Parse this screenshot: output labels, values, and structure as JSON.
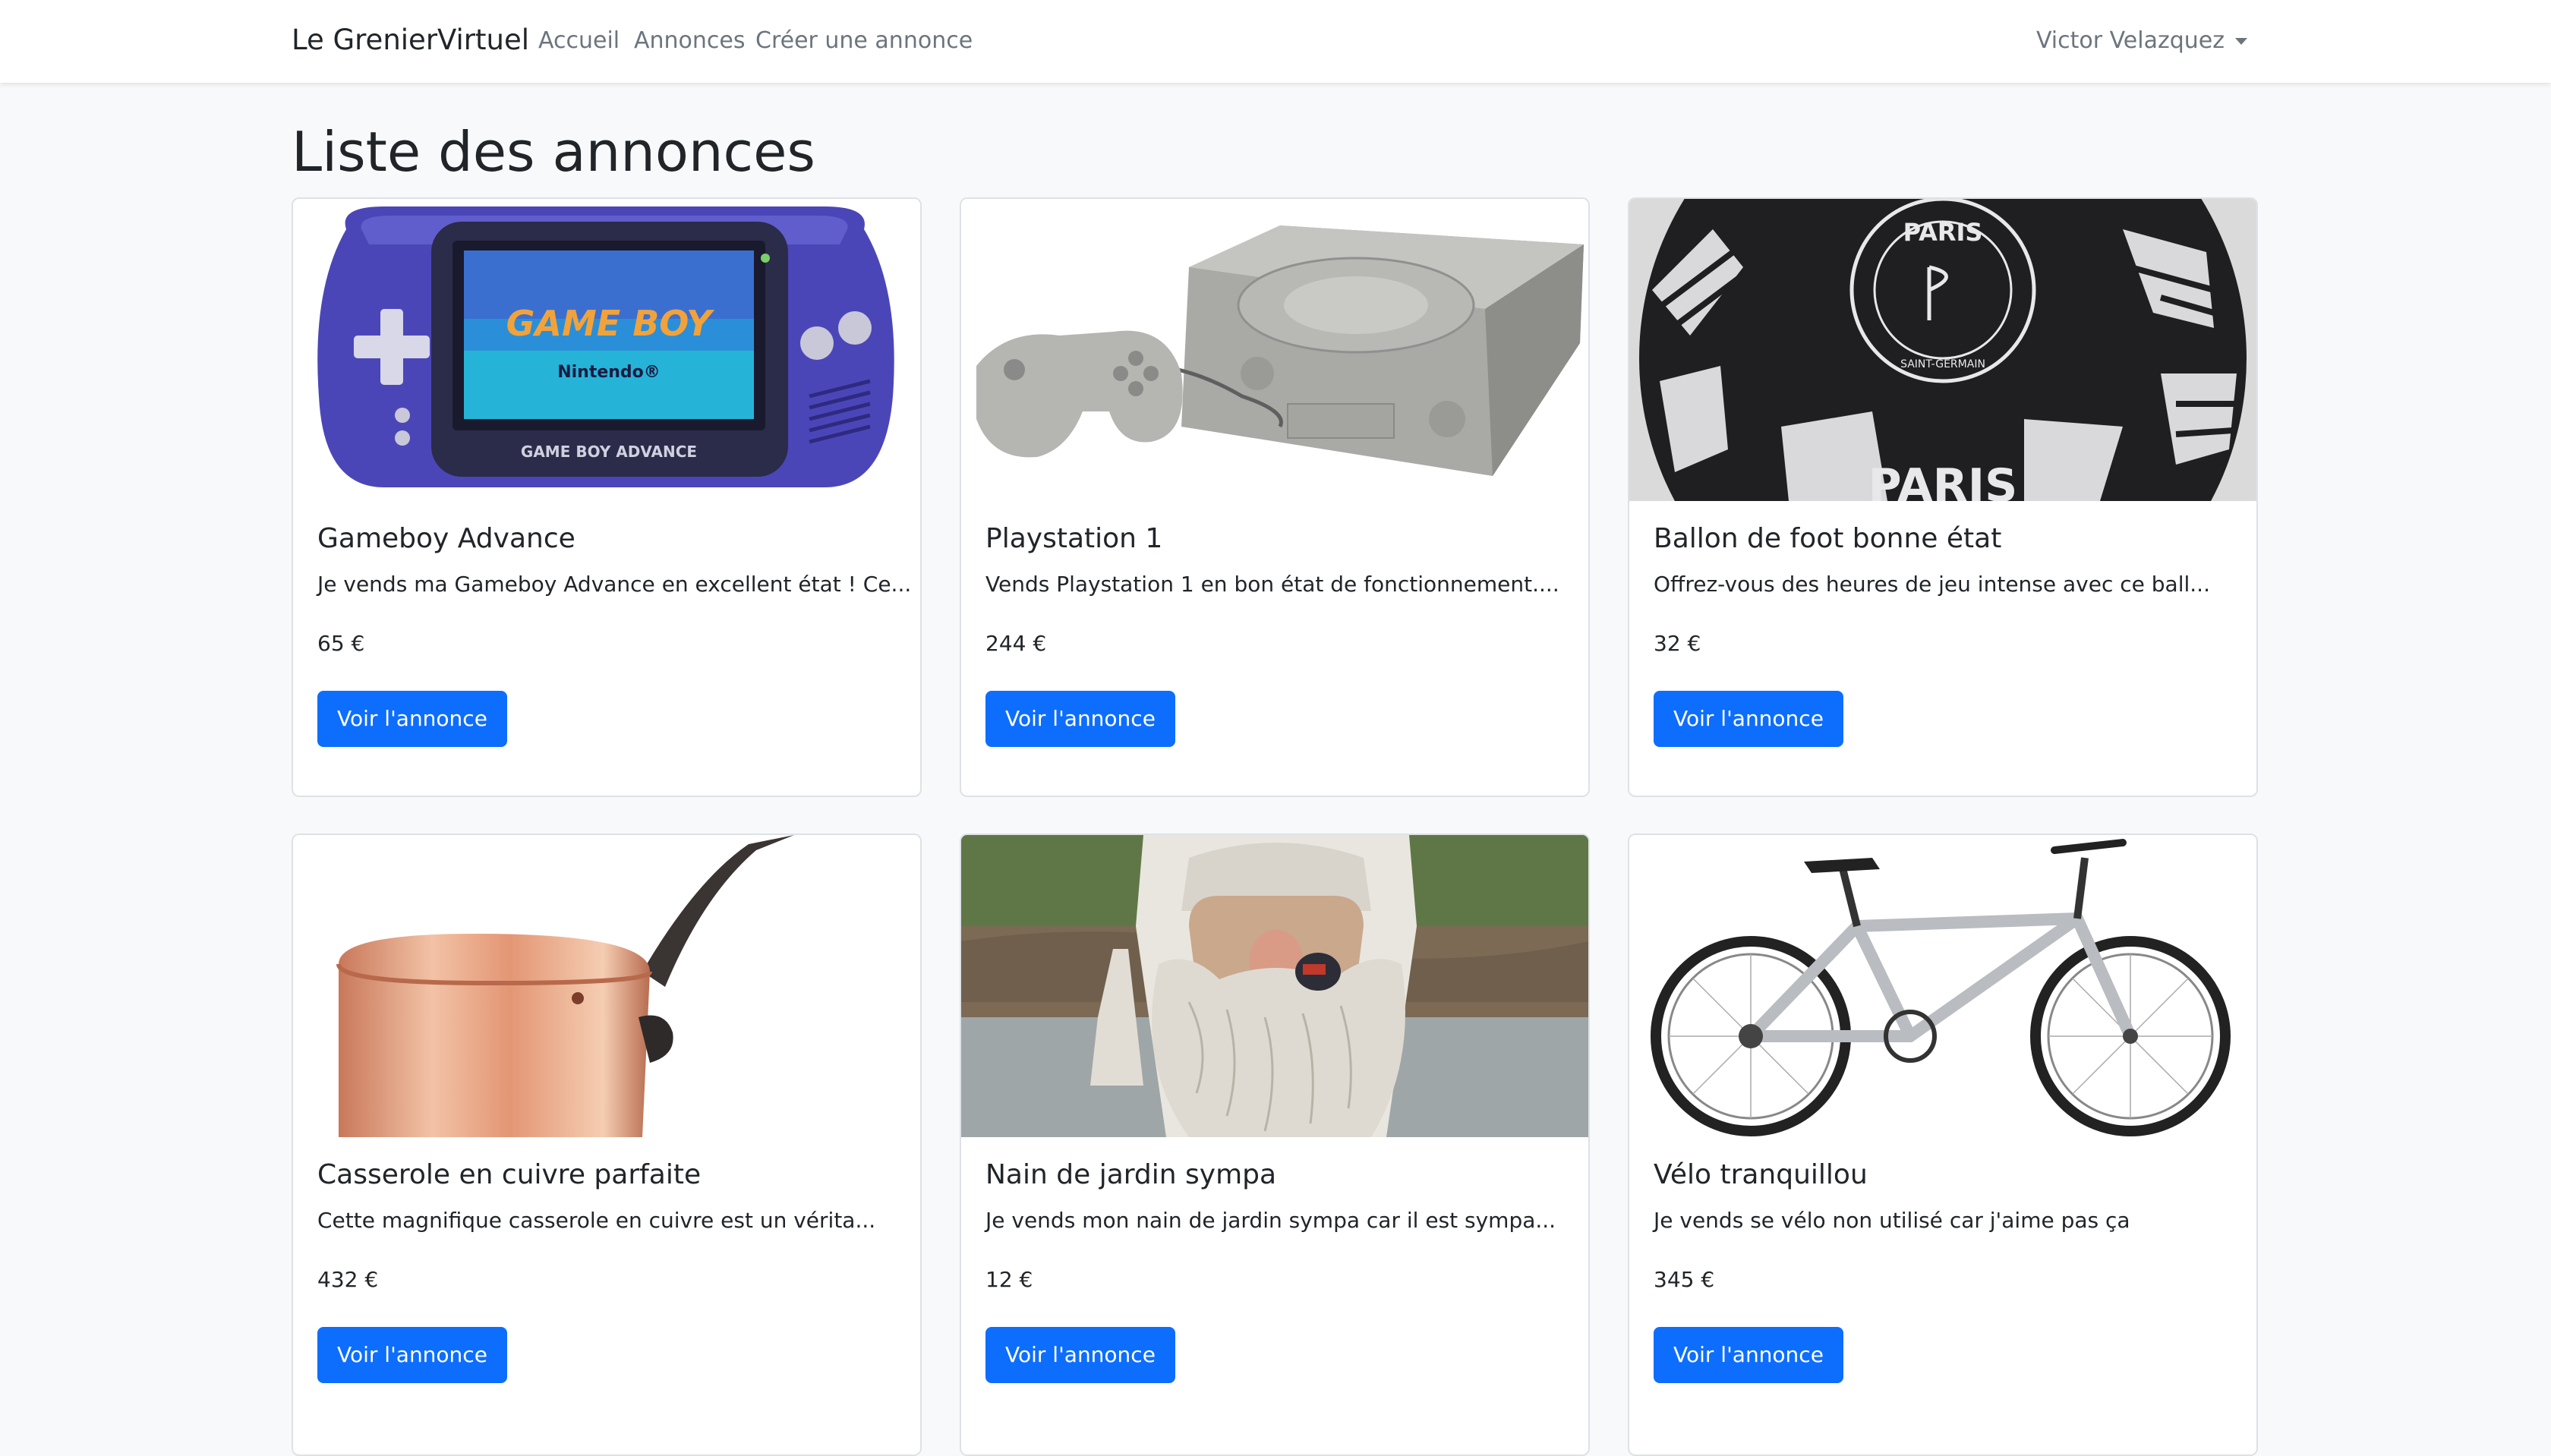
{
  "navbar": {
    "brand": "Le GrenierVirtuel",
    "links": [
      "Accueil",
      "Annonces",
      "Créer une annonce"
    ],
    "user": "Victor Velazquez"
  },
  "page": {
    "title": "Liste des annonces"
  },
  "listings": [
    {
      "title": "Gameboy Advance",
      "description": "Je vends ma Gameboy Advance en excellent état ! Ce...",
      "price": "65 €",
      "button": "Voir l'annonce",
      "image": "gameboy-advance-photo"
    },
    {
      "title": "Playstation 1",
      "description": "Vends Playstation 1 en bon état de fonctionnement....",
      "price": "244 €",
      "button": "Voir l'annonce",
      "image": "playstation-photo"
    },
    {
      "title": "Ballon de foot bonne état",
      "description": "Offrez-vous des heures de jeu intense avec ce ball...",
      "price": "32 €",
      "button": "Voir l'annonce",
      "image": "soccer-ball-photo",
      "image_text": [
        "PARIS",
        "SAINT-GERMAIN",
        "PARIS"
      ]
    },
    {
      "title": "Casserole en cuivre parfaite",
      "description": "Cette magnifique casserole en cuivre est un vérita...",
      "price": "432 €",
      "button": "Voir l'annonce",
      "image": "copper-pot-photo"
    },
    {
      "title": "Nain de jardin sympa",
      "description": "Je vends mon nain de jardin sympa car il est sympa...",
      "price": "12 €",
      "button": "Voir l'annonce",
      "image": "garden-gnome-photo"
    },
    {
      "title": "Vélo tranquillou",
      "description": "Je vends se vélo non utilisé car j'aime pas ça",
      "price": "345 €",
      "button": "Voir l'annonce",
      "image": "bicycle-photo"
    }
  ],
  "colors": {
    "primary": "#0d6efd",
    "background": "#f8f9fa",
    "card_border": "#dee2e6",
    "nav_text": "#6c757d"
  }
}
